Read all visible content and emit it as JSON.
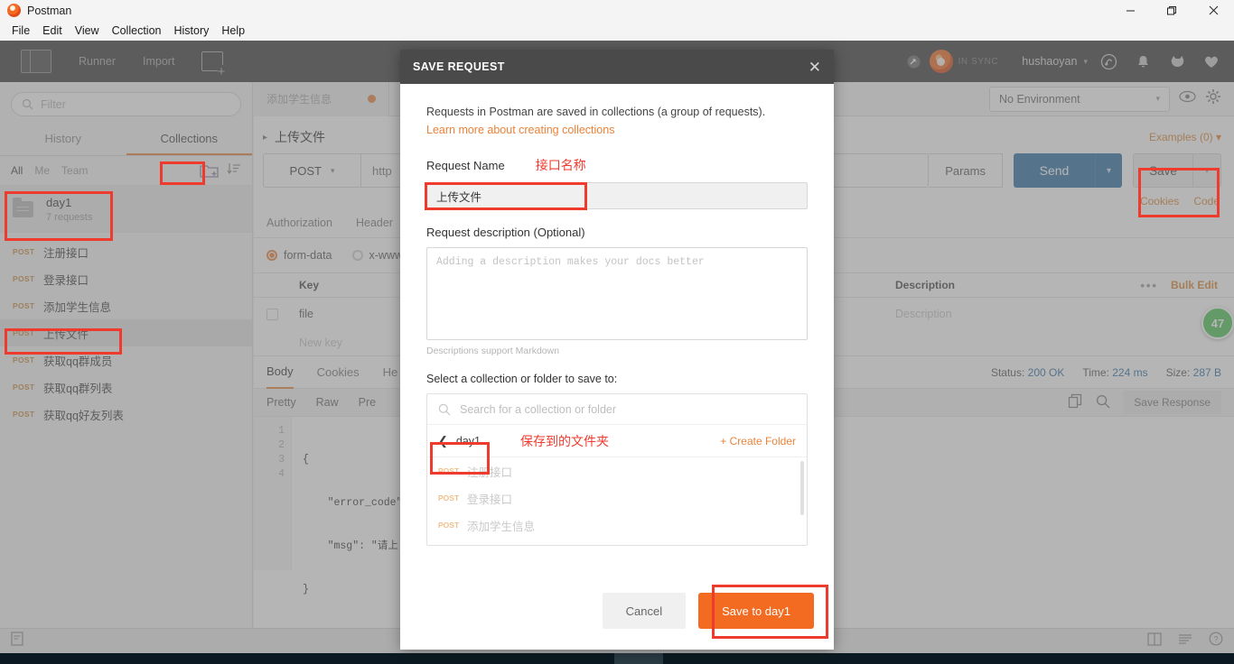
{
  "window": {
    "app_title": "Postman",
    "minimize": "–",
    "maximize": "❐",
    "close": "✕"
  },
  "menubar": {
    "items": [
      "File",
      "Edit",
      "View",
      "Collection",
      "History",
      "Help"
    ]
  },
  "toolbar": {
    "runner_label": "Runner",
    "import_label": "Import",
    "sync_status": "IN SYNC",
    "user_name": "hushaoyan",
    "caret": "▾"
  },
  "sidebar": {
    "filter_placeholder": "Filter",
    "tabs": [
      {
        "label": "History",
        "active": false
      },
      {
        "label": "Collections",
        "active": true
      }
    ],
    "scopes": [
      {
        "label": "All",
        "active": true
      },
      {
        "label": "Me",
        "active": false
      },
      {
        "label": "Team",
        "active": false
      }
    ],
    "collection": {
      "name": "day1",
      "meta": "7 requests"
    },
    "requests": [
      {
        "method": "POST",
        "name": "注册接口",
        "selected": false
      },
      {
        "method": "POST",
        "name": "登录接口",
        "selected": false
      },
      {
        "method": "POST",
        "name": "添加学生信息",
        "selected": false
      },
      {
        "method": "POST",
        "name": "上传文件",
        "selected": true
      },
      {
        "method": "POST",
        "name": "获取qq群成员",
        "selected": false
      },
      {
        "method": "POST",
        "name": "获取qq群列表",
        "selected": false
      },
      {
        "method": "POST",
        "name": "获取qq好友列表",
        "selected": false
      }
    ]
  },
  "main": {
    "tab_label": "添加学生信息",
    "breadcrumb_caret": "▸",
    "breadcrumb_name": "上传文件",
    "examples_label": "Examples (0) ▾",
    "method": "POST",
    "method_caret": "▾",
    "url_value": "http",
    "params_label": "Params",
    "send_label": "Send",
    "send_caret": "▾",
    "save_label": "Save",
    "save_caret": "▾",
    "cookies_label": "Cookies",
    "code_label": "Code",
    "request_tabs": [
      "Authorization",
      "Header"
    ],
    "body_types": [
      {
        "label": "form-data",
        "selected": true
      },
      {
        "label": "x-www",
        "selected": false
      }
    ],
    "kv_headers": {
      "key": "Key",
      "description": "Description"
    },
    "kv_rows": [
      {
        "key": "file",
        "description": "Description"
      },
      {
        "key": "New key",
        "description": ""
      }
    ],
    "dots": "•••",
    "bulk_edit": "Bulk Edit",
    "environment": "No Environment",
    "env_caret": "▾"
  },
  "response": {
    "tabs": [
      "Body",
      "Cookies",
      "He"
    ],
    "active_tab": "Body",
    "status_label": "Status:",
    "status_value": "200 OK",
    "time_label": "Time:",
    "time_value": "224 ms",
    "size_label": "Size:",
    "size_value": "287 B",
    "formats": [
      "Pretty",
      "Raw",
      "Pre"
    ],
    "save_response": "Save Response",
    "line_numbers": [
      "1",
      "2",
      "3",
      "4"
    ],
    "code_lines": [
      "{",
      "    \"error_code\"",
      "    \"msg\": \"请上",
      "}"
    ]
  },
  "badge": {
    "value": "47"
  },
  "modal": {
    "title": "SAVE REQUEST",
    "close": "✕",
    "description": "Requests in Postman are saved in collections (a group of requests).",
    "link": "Learn more about creating collections",
    "request_name_label": "Request Name",
    "request_name_annotation": "接口名称",
    "request_name_value": "上传文件",
    "description_label": "Request description (Optional)",
    "description_placeholder": "Adding a description makes your docs better",
    "markdown_hint": "Descriptions support Markdown",
    "select_label": "Select a collection or folder to save to:",
    "search_placeholder": "Search for a collection or folder",
    "crumb_back": "❮",
    "crumb_name": "day1",
    "crumb_annotation": "保存到的文件夹",
    "create_folder": "+ Create Folder",
    "list_items": [
      {
        "method": "POST",
        "name": "注册接口"
      },
      {
        "method": "POST",
        "name": "登录接口"
      },
      {
        "method": "POST",
        "name": "添加学生信息"
      }
    ],
    "cancel_label": "Cancel",
    "save_label": "Save to day1"
  },
  "colors": {
    "accent_orange": "#f26b21",
    "link_orange": "#e8833a",
    "send_blue": "#2e6da4",
    "annotation_red": "#ef3b2d",
    "badge_green": "#4bc453"
  }
}
